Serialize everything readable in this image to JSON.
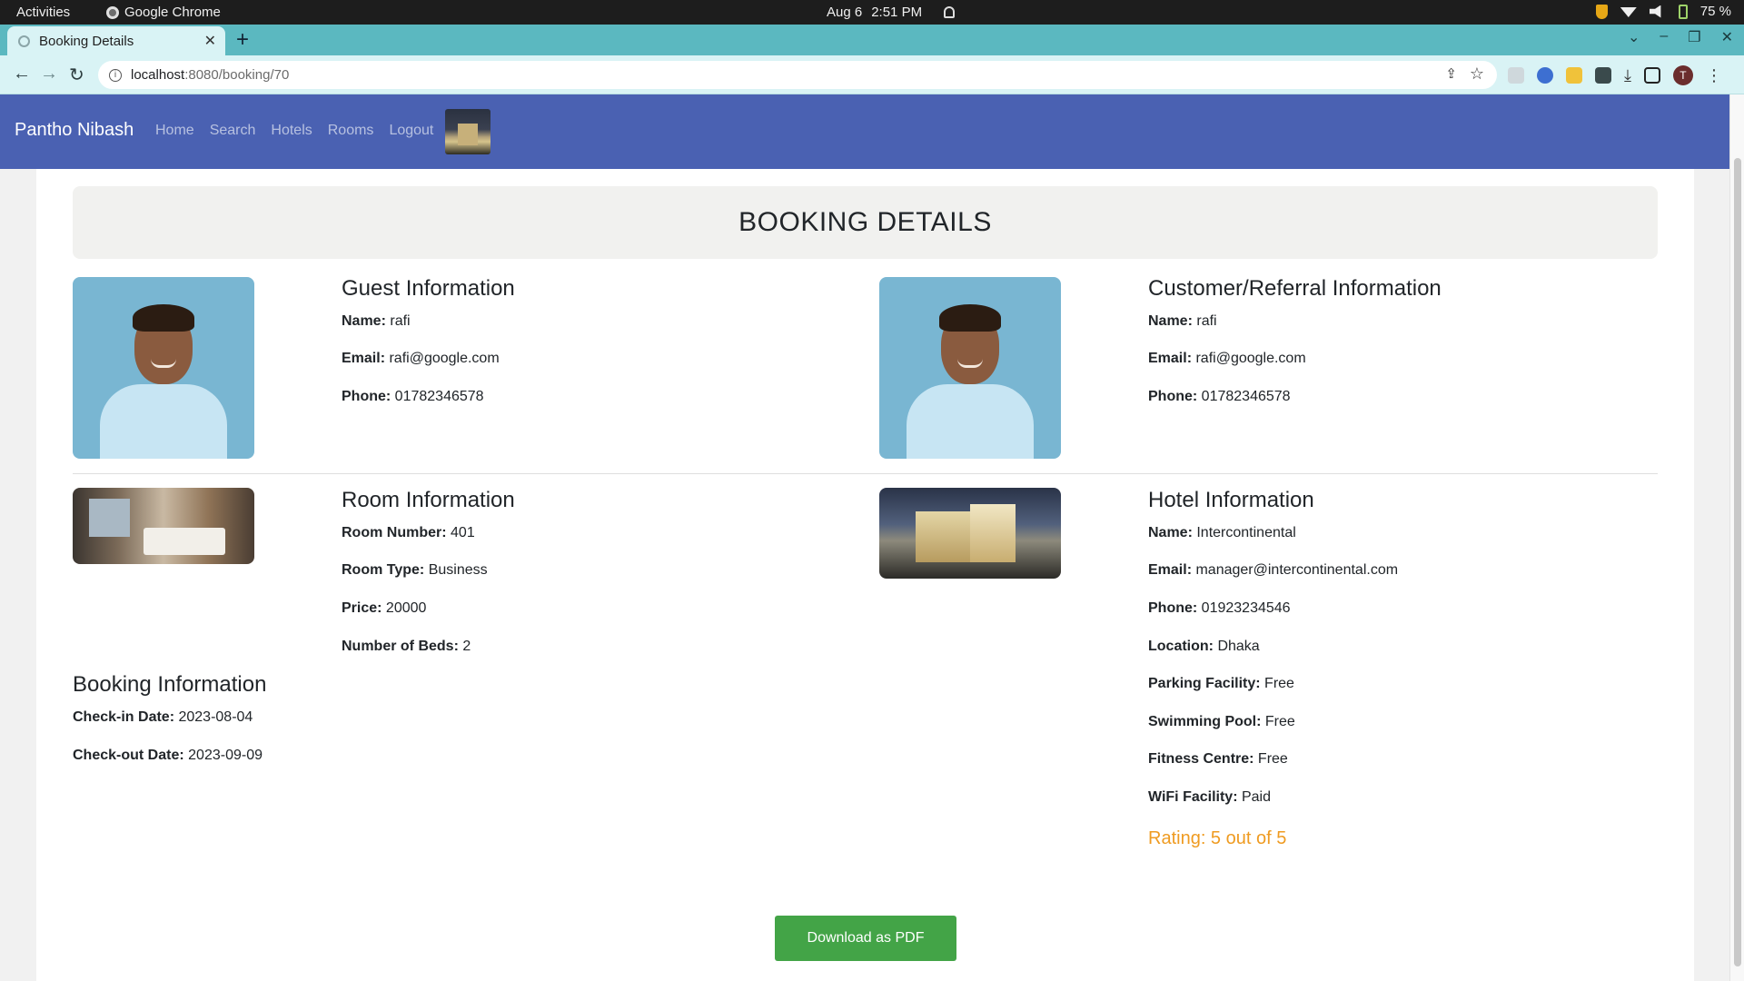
{
  "os": {
    "activities": "Activities",
    "app_name": "Google Chrome",
    "date": "Aug 6",
    "time": "2:51 PM",
    "battery": "75 %"
  },
  "browser": {
    "tab_title": "Booking Details",
    "url_host": "localhost",
    "url_path": ":8080/booking/70",
    "avatar_letter": "T"
  },
  "nav": {
    "brand": "Pantho Nibash",
    "links": [
      "Home",
      "Search",
      "Hotels",
      "Rooms",
      "Logout"
    ]
  },
  "page": {
    "title": "BOOKING DETAILS",
    "guest": {
      "heading": "Guest Information",
      "name_label": "Name:",
      "name": "rafi",
      "email_label": "Email:",
      "email": "rafi@google.com",
      "phone_label": "Phone:",
      "phone": "01782346578"
    },
    "customer": {
      "heading": "Customer/Referral Information",
      "name_label": "Name:",
      "name": "rafi",
      "email_label": "Email:",
      "email": "rafi@google.com",
      "phone_label": "Phone:",
      "phone": "01782346578"
    },
    "room": {
      "heading": "Room Information",
      "number_label": "Room Number:",
      "number": "401",
      "type_label": "Room Type:",
      "type": "Business",
      "price_label": "Price:",
      "price": "20000",
      "beds_label": "Number of Beds:",
      "beds": "2"
    },
    "booking": {
      "heading": "Booking Information",
      "checkin_label": "Check-in Date:",
      "checkin": "2023-08-04",
      "checkout_label": "Check-out Date:",
      "checkout": "2023-09-09"
    },
    "hotel": {
      "heading": "Hotel Information",
      "name_label": "Name:",
      "name": "Intercontinental",
      "email_label": "Email:",
      "email": "manager@intercontinental.com",
      "phone_label": "Phone:",
      "phone": "01923234546",
      "location_label": "Location:",
      "location": "Dhaka",
      "parking_label": "Parking Facility:",
      "parking": "Free",
      "pool_label": "Swimming Pool:",
      "pool": "Free",
      "fitness_label": "Fitness Centre:",
      "fitness": "Free",
      "wifi_label": "WiFi Facility:",
      "wifi": "Paid",
      "rating": "Rating: 5 out of 5"
    },
    "download_button": "Download as PDF"
  },
  "colors": {
    "nav_bg": "#4a61b2",
    "tab_strip": "#5bb8c0",
    "rating": "#ef9b21",
    "button": "#43a447"
  }
}
